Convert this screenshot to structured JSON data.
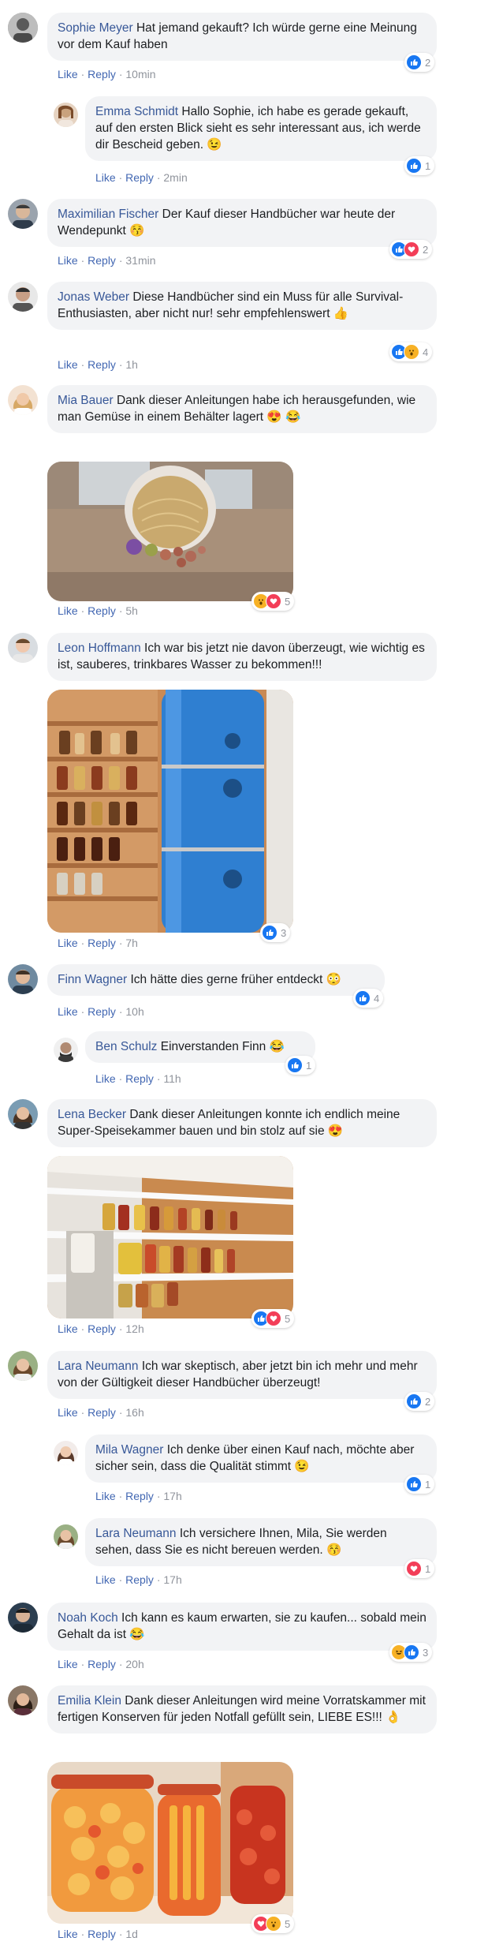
{
  "ui": {
    "like_label": "Like",
    "reply_label": "Reply",
    "dot": "·"
  },
  "comments": [
    {
      "name": "Sophie Meyer",
      "text": "Hat jemand gekauft? Ich würde gerne eine Meinung vor dem Kauf haben",
      "time": "10min",
      "reactions": [
        "like"
      ],
      "count": "2"
    },
    {
      "name": "Emma Schmidt",
      "text": "Hallo Sophie, ich habe es gerade gekauft, auf den ersten Blick sieht es sehr interessant aus, ich werde dir Bescheid geben. 😉",
      "time": "2min",
      "reactions": [
        "like"
      ],
      "count": "1",
      "reply": true
    },
    {
      "name": "Maximilian Fischer",
      "text": "Der Kauf dieser Handbücher war heute der Wendepunkt 😚",
      "time": "31min",
      "reactions": [
        "like",
        "love"
      ],
      "count": "2"
    },
    {
      "name": "Jonas Weber",
      "text": "Diese Handbücher sind ein Muss für alle Survival-Enthusiasten, aber nicht nur! sehr empfehlenswert 👍",
      "time": "1h",
      "reactions": [
        "like",
        "wow"
      ],
      "count": "4"
    },
    {
      "name": "Mia Bauer",
      "text": "Dank dieser Anleitungen habe ich herausgefunden, wie man Gemüse in einem Behälter lagert 😍 😂",
      "time": "5h",
      "reactions": [
        "wow",
        "love"
      ],
      "count": "5",
      "image": "vegetables-in-bucket"
    },
    {
      "name": "Leon Hoffmann",
      "text": "Ich war bis jetzt nie davon überzeugt, wie wichtig es ist, sauberes, trinkbares Wasser zu bekommen!!!",
      "time": "7h",
      "reactions": [
        "like"
      ],
      "count": "3",
      "image": "water-barrels-pantry"
    },
    {
      "name": "Finn Wagner",
      "text": "Ich hätte dies gerne früher entdeckt 😳",
      "time": "10h",
      "reactions": [
        "like"
      ],
      "count": "4"
    },
    {
      "name": "Ben Schulz",
      "text": "Einverstanden Finn 😂",
      "time": "11h",
      "reactions": [
        "like"
      ],
      "count": "1",
      "reply": true
    },
    {
      "name": "Lena Becker",
      "text": "Dank dieser Anleitungen konnte ich endlich meine Super-Speisekammer bauen und bin stolz auf sie 😍",
      "time": "12h",
      "reactions": [
        "like",
        "love"
      ],
      "count": "5",
      "image": "pantry-shelves"
    },
    {
      "name": "Lara Neumann",
      "text": "Ich war skeptisch, aber jetzt bin ich mehr und mehr von der Gültigkeit dieser Handbücher überzeugt!",
      "time": "16h",
      "reactions": [
        "like"
      ],
      "count": "2"
    },
    {
      "name": "Mila Wagner",
      "text": "Ich denke über einen Kauf nach, möchte aber sicher sein, dass die Qualität stimmt 😉",
      "time": "17h",
      "reactions": [
        "like"
      ],
      "count": "1",
      "reply": true
    },
    {
      "name": "Lara Neumann",
      "text": "Ich versichere Ihnen, Mila, Sie werden sehen, dass Sie es nicht bereuen werden. 😚",
      "time": "17h",
      "reactions": [
        "love"
      ],
      "count": "1",
      "reply": true
    },
    {
      "name": "Noah Koch",
      "text": "Ich kann es kaum erwarten, sie zu kaufen... sobald mein Gehalt da ist 😂",
      "time": "20h",
      "reactions": [
        "haha",
        "like"
      ],
      "count": "3"
    },
    {
      "name": "Emilia Klein",
      "text": "Dank dieser Anleitungen wird meine Vorratskammer mit fertigen Konserven für jeden Notfall gefüllt sein, LIEBE ES!!! 👌",
      "time": "1d",
      "reactions": [
        "love",
        "wow"
      ],
      "count": "5",
      "image": "preserve-jars"
    }
  ],
  "colors": {
    "name": "#385898",
    "link": "#4267b2",
    "bubble": "#f2f3f5",
    "meta": "#90949c",
    "like": "#1877f2",
    "love": "#f33e58",
    "wow": "#f7b125"
  }
}
